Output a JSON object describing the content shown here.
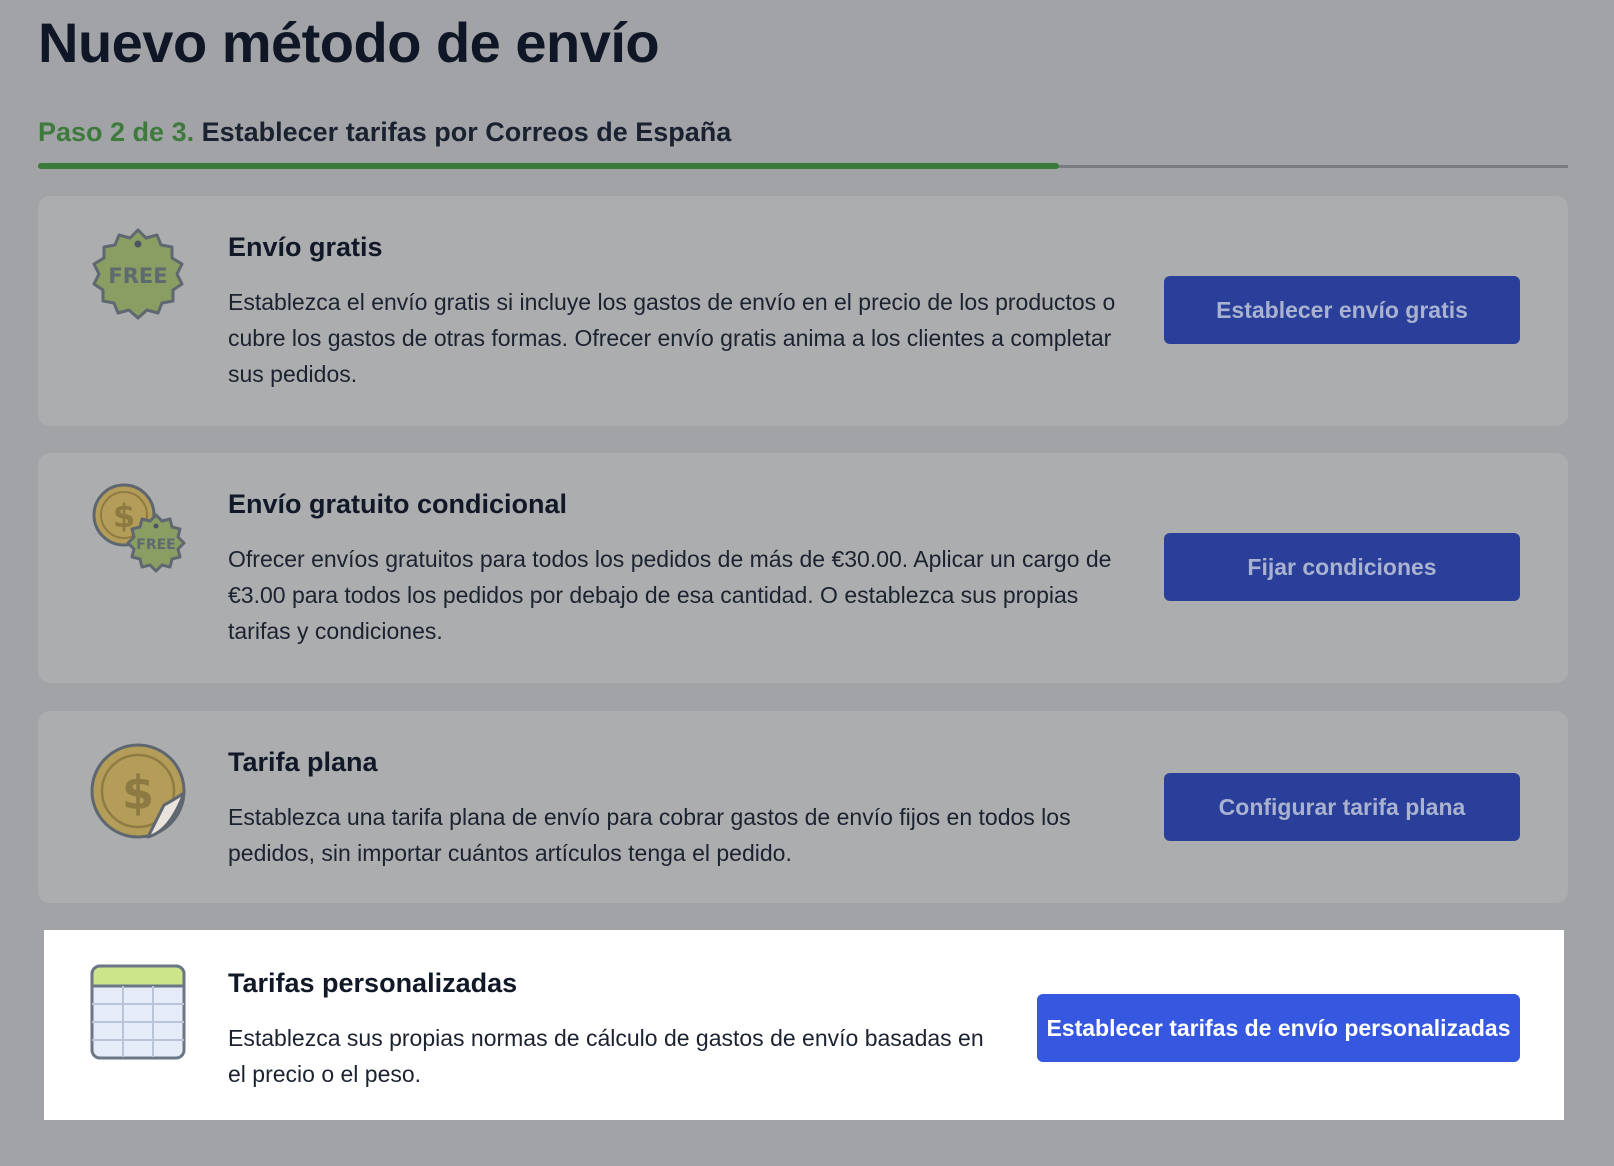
{
  "header": {
    "title": "Nuevo método de envío",
    "step_number": "Paso 2 de 3.",
    "step_description": "Establecer tarifas por Correos de España",
    "progress_fraction": 0.667
  },
  "options": [
    {
      "icon": "free-tag-icon",
      "icon_text": "FREE",
      "title": "Envío gratis",
      "description": "Establezca el envío gratis si incluye los gastos de envío en el precio de los productos o cubre los gastos de otras formas. Ofrecer envío gratis anima a los clientes a completar sus pedidos.",
      "button": "Establecer envío gratis"
    },
    {
      "icon": "coin-free-icon",
      "icon_text": "FREE",
      "title": "Envío gratuito condicional",
      "description": "Ofrecer envíos gratuitos para todos los pedidos de más de €30.00. Aplicar un cargo de €3.00 para todos los pedidos por debajo de esa cantidad. O establezca sus propias tarifas y condiciones.",
      "button": "Fijar condiciones"
    },
    {
      "icon": "dollar-coin-icon",
      "title": "Tarifa plana",
      "description": "Establezca una tarifa plana de envío para cobrar gastos de envío fijos en todos los pedidos, sin importar cuántos artículos tenga el pedido.",
      "button": "Configurar tarifa plana"
    },
    {
      "icon": "spreadsheet-icon",
      "title": "Tarifas personalizadas",
      "description": "Establezca sus propias normas de cálculo de gastos de envío basadas en el precio o el peso.",
      "button": "Establecer tarifas de envío personalizadas"
    }
  ],
  "colors": {
    "step_green": "#3d7a3c",
    "button_dimmed": "#2a3f9a",
    "button_active": "#3657e0",
    "overlay_bg": "#a1a3a6"
  }
}
